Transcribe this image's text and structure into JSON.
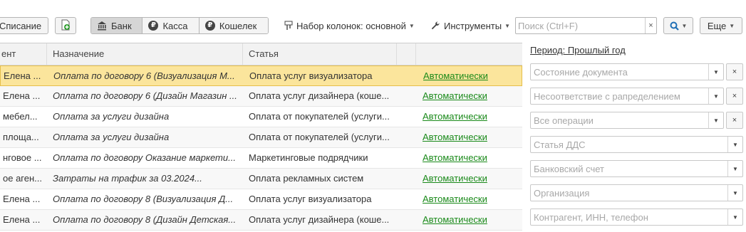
{
  "toolbar": {
    "write_off_label": "Списание",
    "add_icon": "add-document-icon",
    "segments": [
      {
        "label": "Банк",
        "icon": "bank-icon",
        "active": true
      },
      {
        "label": "Касса",
        "icon": "ruble-icon",
        "active": false
      },
      {
        "label": "Кошелек",
        "icon": "ruble-icon",
        "active": false
      }
    ],
    "columns_label": "Набор колонок: основной",
    "tools_label": "Инструменты",
    "search_placeholder": "Поиск (Ctrl+F)",
    "search_clear": "×",
    "more_label": "Еще"
  },
  "table": {
    "headers": [
      "ент",
      "Назначение",
      "Статья",
      "",
      ""
    ],
    "rows": [
      {
        "c1": "Елена ...",
        "purpose": "Оплата по договору 6 (Визуализация М...",
        "article": "Оплата услуг визуализатора",
        "link": "Автоматически",
        "selected": true
      },
      {
        "c1": "Елена ...",
        "purpose": "Оплата по договору 6 (Дизайн Магазин ...",
        "article": "Оплата услуг дизайнера (коше...",
        "link": "Автоматически",
        "selected": false
      },
      {
        "c1": "мебел...",
        "purpose": "Оплата за услуги дизайна",
        "article": "Оплата от покупателей (услуги...",
        "link": "Автоматически",
        "selected": false
      },
      {
        "c1": "площа...",
        "purpose": "Оплата за услуги дизайна",
        "article": "Оплата от покупателей (услуги...",
        "link": "Автоматически",
        "selected": false
      },
      {
        "c1": "нговое ...",
        "purpose": "Оплата по договору Оказание маркети...",
        "article": "Маркетинговые подрядчики",
        "link": "Автоматически",
        "selected": false
      },
      {
        "c1": "ое аген...",
        "purpose": "Затраты на трафик за 03.2024...",
        "article": "Оплата рекламных систем",
        "link": "Автоматически",
        "selected": false
      },
      {
        "c1": "Елена ...",
        "purpose": "Оплата по договору 8 (Визуализация Д...",
        "article": "Оплата услуг визуализатора",
        "link": "Автоматически",
        "selected": false
      },
      {
        "c1": "Елена ...",
        "purpose": "Оплата по договору 8 (Дизайн Детская...",
        "article": "Оплата услуг дизайнера (коше...",
        "link": "Автоматически",
        "selected": false
      }
    ]
  },
  "panel": {
    "period": "Период: Прошлый год",
    "filters": [
      {
        "placeholder": "Состояние документа",
        "clear": true
      },
      {
        "placeholder": "Несоответствие с рапределением",
        "clear": true
      },
      {
        "placeholder": "Все операции",
        "clear": true
      },
      {
        "placeholder": "Статья ДДС",
        "clear": false
      },
      {
        "placeholder": "Банковский счет",
        "clear": false
      },
      {
        "placeholder": "Организация",
        "clear": false
      },
      {
        "placeholder": "Контрагент, ИНН, телефон",
        "clear": false
      }
    ],
    "clear_glyph": "×"
  },
  "colors": {
    "selected_row": "#fbe59c",
    "link": "#1a8a1a",
    "accent": "#1f6fb5"
  }
}
